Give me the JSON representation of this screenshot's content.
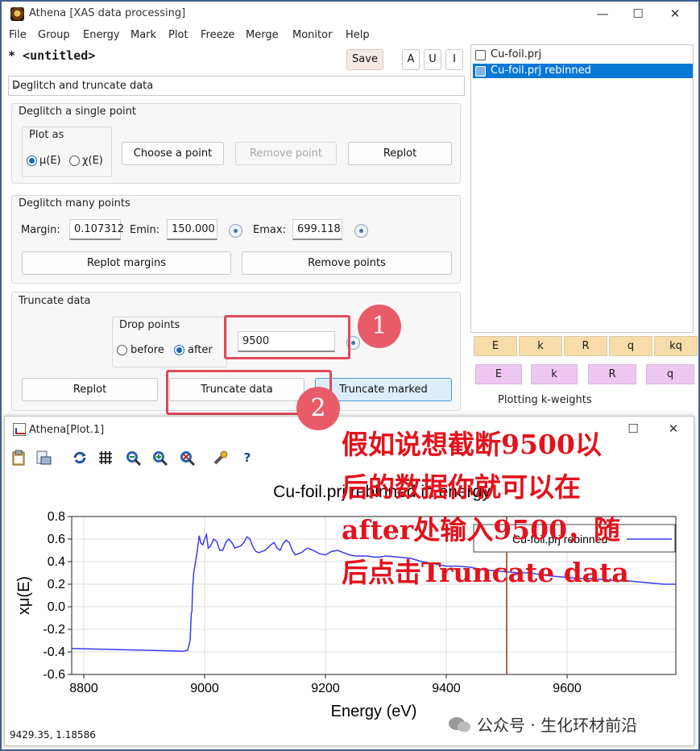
{
  "window": {
    "title": "Athena [XAS data processing]",
    "controls": [
      "—",
      "☐",
      "✕"
    ]
  },
  "menu": [
    "File",
    "Group",
    "Energy",
    "Mark",
    "Plot",
    "Freeze",
    "Merge",
    "Monitor",
    "Help"
  ],
  "project": {
    "name": "* <untitled>",
    "save_label": "Save",
    "mark_buttons": [
      "A",
      "U",
      "I"
    ]
  },
  "tool_select": {
    "value": "Deglitch and truncate data"
  },
  "deglitch_single": {
    "label": "Deglitch a single point",
    "plot_as_label": "Plot as",
    "options": [
      "μ(E)",
      "χ(E)"
    ],
    "selected": "μ(E)",
    "choose_label": "Choose a point",
    "remove_label": "Remove point",
    "replot_label": "Replot"
  },
  "deglitch_many": {
    "label": "Deglitch many points",
    "margin_label": "Margin:",
    "margin_value": "0.107312",
    "emin_label": "Emin:",
    "emin_value": "150.000",
    "emax_label": "Emax:",
    "emax_value": "699.118",
    "replot_margins_label": "Replot margins",
    "remove_points_label": "Remove points"
  },
  "truncate": {
    "label": "Truncate data",
    "drop_label": "Drop points",
    "options": [
      "before",
      "after"
    ],
    "selected": "after",
    "value": "9500",
    "replot_label": "Replot",
    "truncate_label": "Truncate data",
    "truncate_marked_label": "Truncate marked"
  },
  "groups": [
    {
      "name": "Cu-foil.prj",
      "selected": false
    },
    {
      "name": "Cu-foil.prj rebinned",
      "selected": true
    }
  ],
  "plot_buttons_row1": [
    "E",
    "k",
    "R",
    "q",
    "kq"
  ],
  "plot_buttons_row2": [
    "E",
    "k",
    "R",
    "q"
  ],
  "plotting_kweights_label": "Plotting k-weights",
  "annotations": {
    "badge1": "1",
    "badge2": "2"
  },
  "plot_window": {
    "title": "Athena[Plot.1]",
    "maximize": "☐",
    "close": "✕",
    "toolbar_icons": [
      "clipboard-icon",
      "export-icon",
      "refresh-icon",
      "grid-icon",
      "zoom-back-icon",
      "zoom-in-icon",
      "zoom-reset-icon",
      "wrench-icon",
      "help-icon"
    ],
    "help_glyph": "?",
    "status": "9429.35, 1.18586"
  },
  "chart_data": {
    "type": "line",
    "title": "Cu-foil.prj rebinned in energy",
    "xlabel": "Energy    (eV)",
    "ylabel": "xμ(E)",
    "xlim": [
      8780,
      9780
    ],
    "ylim": [
      -0.6,
      0.8
    ],
    "xticks": [
      8800,
      9000,
      9200,
      9400,
      9600
    ],
    "yticks": [
      -0.6,
      -0.4,
      -0.2,
      0,
      0.2,
      0.4,
      0.6,
      0.8
    ],
    "grid": true,
    "legend": "top-right",
    "marker_line_x": 9500,
    "series": [
      {
        "name": "Cu-foil.prj rebinned",
        "color": "#3a3af0",
        "x": [
          8780,
          8820,
          8860,
          8900,
          8940,
          8965,
          8972,
          8976,
          8978,
          8979,
          8980,
          8982,
          8985,
          8988,
          8991,
          8994,
          8997,
          9000,
          9003,
          9006,
          9010,
          9015,
          9020,
          9025,
          9030,
          9035,
          9040,
          9045,
          9050,
          9055,
          9060,
          9065,
          9070,
          9075,
          9080,
          9085,
          9090,
          9100,
          9110,
          9115,
          9120,
          9125,
          9130,
          9135,
          9140,
          9145,
          9150,
          9160,
          9170,
          9180,
          9190,
          9200,
          9210,
          9220,
          9230,
          9240,
          9250,
          9260,
          9270,
          9280,
          9290,
          9300,
          9320,
          9340,
          9360,
          9380,
          9400,
          9420,
          9440,
          9460,
          9480,
          9500,
          9520,
          9540,
          9560,
          9580,
          9600,
          9620,
          9640,
          9660,
          9680,
          9700,
          9720,
          9740,
          9760,
          9780
        ],
        "y": [
          -0.37,
          -0.375,
          -0.38,
          -0.385,
          -0.39,
          -0.395,
          -0.385,
          -0.3,
          -0.06,
          -0.04,
          0.15,
          0.3,
          0.4,
          0.5,
          0.63,
          0.56,
          0.55,
          0.6,
          0.64,
          0.52,
          0.54,
          0.6,
          0.58,
          0.5,
          0.5,
          0.57,
          0.6,
          0.57,
          0.52,
          0.53,
          0.54,
          0.57,
          0.62,
          0.6,
          0.53,
          0.49,
          0.48,
          0.5,
          0.55,
          0.57,
          0.52,
          0.5,
          0.56,
          0.59,
          0.57,
          0.5,
          0.46,
          0.48,
          0.52,
          0.5,
          0.47,
          0.46,
          0.49,
          0.5,
          0.48,
          0.46,
          0.45,
          0.45,
          0.45,
          0.44,
          0.44,
          0.45,
          0.44,
          0.43,
          0.4,
          0.38,
          0.36,
          0.36,
          0.35,
          0.33,
          0.32,
          0.31,
          0.3,
          0.3,
          0.28,
          0.27,
          0.26,
          0.25,
          0.25,
          0.24,
          0.23,
          0.23,
          0.22,
          0.21,
          0.2,
          0.2
        ]
      }
    ]
  },
  "overlay_note": {
    "lines": [
      "假如说想截断9500以",
      "后的数据你就可以在",
      "after处输入9500，随",
      "后点击Truncate data"
    ]
  },
  "watermark": "公众号 · 生化环材前沿"
}
